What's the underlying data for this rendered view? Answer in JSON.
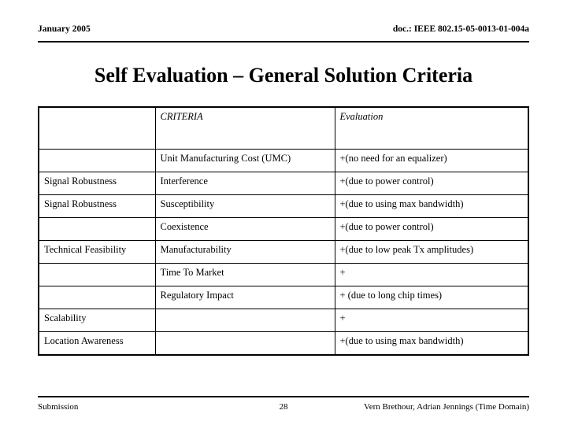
{
  "header": {
    "date": "January 2005",
    "doc_number": "doc.: IEEE 802.15-05-0013-01-004a"
  },
  "title": "Self Evaluation – General Solution Criteria",
  "table": {
    "columns": [
      "",
      "CRITERIA",
      "Evaluation"
    ],
    "rows": [
      {
        "category": "",
        "criteria": "Unit Manufacturing Cost (UMC)",
        "evaluation": "+(no need for an equalizer)"
      },
      {
        "category": "Signal Robustness",
        "criteria": "Interference",
        "evaluation": "+(due to power control)"
      },
      {
        "category": "Signal Robustness",
        "criteria": "Susceptibility",
        "evaluation": "+(due to using max bandwidth)"
      },
      {
        "category": "",
        "criteria": "Coexistence",
        "evaluation": "+(due to power control)"
      },
      {
        "category": "Technical Feasibility",
        "criteria": "Manufacturability",
        "evaluation": "+(due to low peak Tx amplitudes)"
      },
      {
        "category": "",
        "criteria": "Time To Market",
        "evaluation": "+"
      },
      {
        "category": "",
        "criteria": "Regulatory Impact",
        "evaluation": "+ (due to long chip times)"
      },
      {
        "category": "Scalability",
        "criteria": "",
        "evaluation": "+"
      },
      {
        "category": "Location Awareness",
        "criteria": "",
        "evaluation": "+(due to using max bandwidth)"
      }
    ]
  },
  "footer": {
    "left": "Submission",
    "page": "28",
    "right": "Vern Brethour, Adrian Jennings (Time Domain)"
  }
}
